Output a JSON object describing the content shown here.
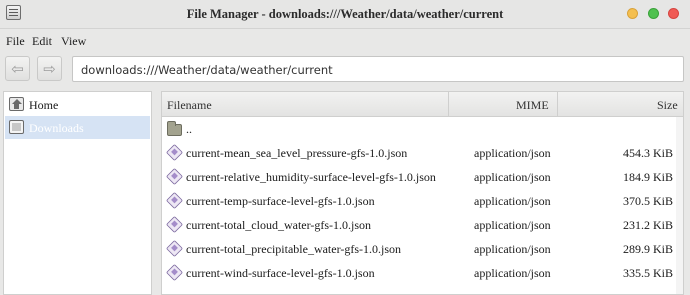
{
  "window": {
    "title": "File Manager - downloads:///Weather/data/weather/current",
    "app_icon": "file-manager-icon"
  },
  "menu": [
    "File",
    "Edit",
    "View"
  ],
  "toolbar": {
    "back_icon": "back-arrow-icon",
    "forward_icon": "forward-arrow-icon",
    "address": "downloads:///Weather/data/weather/current"
  },
  "sidebar": {
    "items": [
      {
        "label": "Home",
        "icon": "home-icon",
        "selected": false
      },
      {
        "label": "Downloads",
        "icon": "downloads-icon",
        "selected": true
      }
    ]
  },
  "filelist": {
    "columns": [
      "Filename",
      "MIME",
      "Size"
    ],
    "parent": "..",
    "files": [
      {
        "name": "current-mean_sea_level_pressure-gfs-1.0.json",
        "mime": "application/json",
        "size": "454.3 KiB"
      },
      {
        "name": "current-relative_humidity-surface-level-gfs-1.0.json",
        "mime": "application/json",
        "size": "184.9 KiB"
      },
      {
        "name": "current-temp-surface-level-gfs-1.0.json",
        "mime": "application/json",
        "size": "370.5 KiB"
      },
      {
        "name": "current-total_cloud_water-gfs-1.0.json",
        "mime": "application/json",
        "size": "231.2 KiB"
      },
      {
        "name": "current-total_precipitable_water-gfs-1.0.json",
        "mime": "application/json",
        "size": "289.9 KiB"
      },
      {
        "name": "current-wind-surface-level-gfs-1.0.json",
        "mime": "application/json",
        "size": "335.5 KiB"
      }
    ]
  },
  "colors": {
    "selection": "#d6e3f4",
    "close": "#f05b55",
    "minimize": "#f4bf4f",
    "maximize": "#4fc14f"
  }
}
